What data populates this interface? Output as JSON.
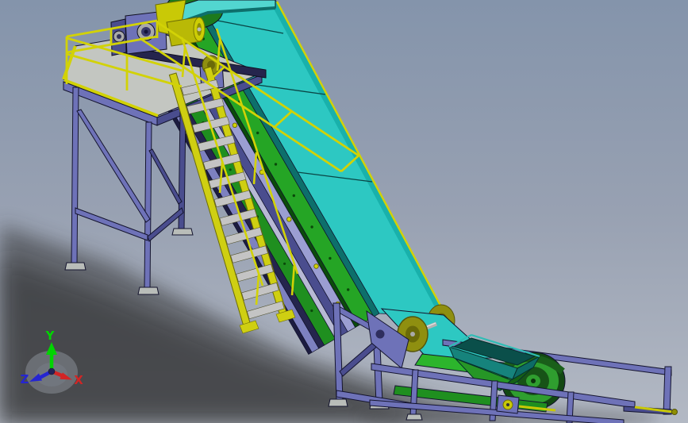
{
  "viewport": {
    "type": "cad-3d-viewport",
    "model": "inclined-belt-conveyor-with-access-platform"
  },
  "triad": {
    "axes": [
      {
        "label": "Y",
        "color": "#00d400",
        "direction": "up"
      },
      {
        "label": "Z",
        "color": "#2525d2",
        "direction": "lower-left"
      },
      {
        "label": "X",
        "color": "#d22525",
        "direction": "lower-right"
      }
    ]
  },
  "colors": {
    "bg_top": "#8494ab",
    "bg_mid": "#98a1b2",
    "bg_bottom": "#b3b9c4",
    "shadow": "#2d2d2d",
    "frame_main": "#6e72b8",
    "frame_light": "#9b9ed2",
    "frame_dark": "#4a4d8e",
    "frame_deep": "#25254d",
    "rail_pale": "#b7b9d4",
    "rail_mid": "#7d81c0",
    "edge_dark": "#1c1c40",
    "deck_gray": "#c3c6c1",
    "base_plate": "#b9bdb9",
    "yellow_rail": "#d2d206",
    "yellow_dark": "#8f8f04",
    "stair_yellow": "#cfcf12",
    "tread_gray": "#c4c4c4",
    "motor_yellow": "#b9b906",
    "bracket_yellow": "#c9c906",
    "belt_teal": "#2dc8c2",
    "belt_teal_light": "#52d6d0",
    "belt_facet": "#19b1ab",
    "belt_edge": "#0d6f6b",
    "green_plate": "#25a525",
    "green_dark": "#0b4b0b",
    "green_return": "#1f8f1f",
    "green_belt_bright": "#2cb52c",
    "olive_disc": "#8f8f10",
    "olive_ring": "#6a6a08",
    "shaft_gray": "#b3b3b3",
    "drum_dark": "#134813",
    "drum_mid": "#2f9e2f",
    "drum_inner": "#175317",
    "hopper_teal": "#16837c",
    "hopper_dark": "#0a4f4a",
    "hopper_side": "#0d6b66",
    "hopper_green": "#269626",
    "hopper_rim": "#2fbdb5",
    "head_drum_green": "#1d7a1d",
    "steel_gray": "#a9a9a9"
  }
}
